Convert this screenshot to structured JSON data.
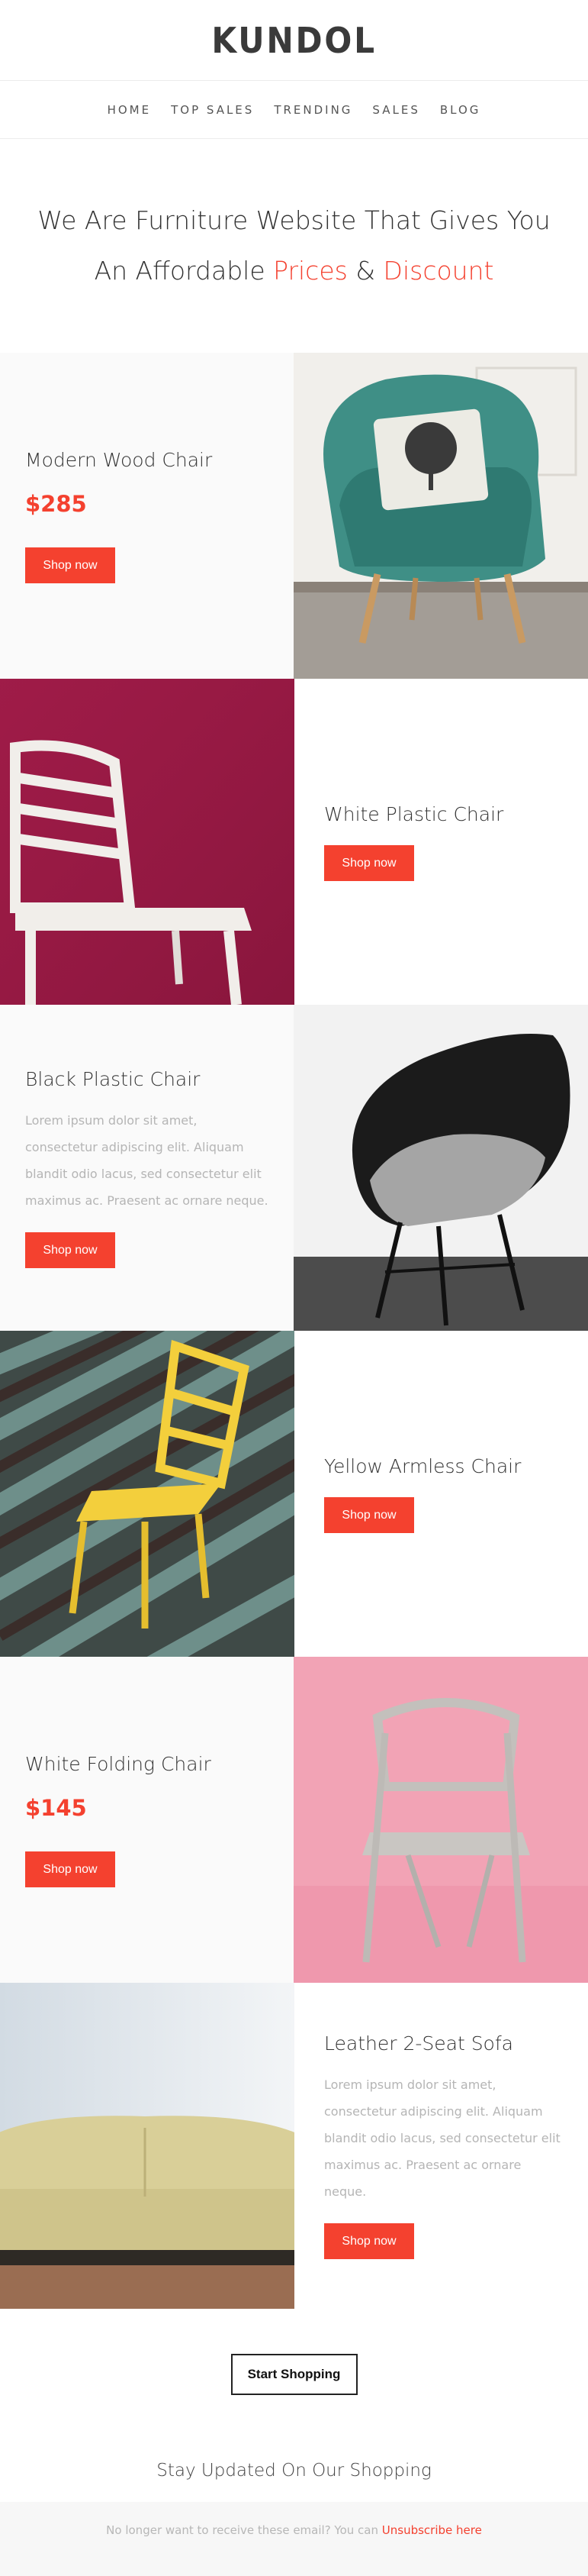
{
  "brand": {
    "logo_text": "KUNDOL"
  },
  "nav": {
    "items": [
      {
        "label": "HOME"
      },
      {
        "label": "TOP SALES"
      },
      {
        "label": "TRENDING"
      },
      {
        "label": "SALES"
      },
      {
        "label": "BLOG"
      }
    ]
  },
  "hero": {
    "line1": "We Are Furniture Website That Gives You",
    "line2_prefix": "An Affordable ",
    "line2_accent1": "Prices",
    "line2_amp": " & ",
    "line2_accent2": "Discount"
  },
  "products": [
    {
      "title": "Modern Wood Chair",
      "price": "$285",
      "button": "Shop now"
    },
    {
      "title": "White Plastic Chair",
      "button": "Shop now"
    },
    {
      "title": "Black Plastic Chair",
      "description": "Lorem ipsum dolor sit amet, consectetur adipiscing elit. Aliquam blandit odio lacus, sed consectetur elit maximus ac. Praesent ac ornare neque.",
      "button": "Shop now"
    },
    {
      "title": "Yellow Armless Chair",
      "button": "Shop now"
    },
    {
      "title": "White Folding Chair",
      "price": "$145",
      "button": "Shop now"
    },
    {
      "title": "Leather 2-Seat Sofa",
      "description": "Lorem ipsum dolor sit amet, consectetur adipiscing elit. Aliquam blandit odio lacus, sed consectetur elit maximus ac. Praesent ac ornare neque.",
      "button": "Shop now"
    }
  ],
  "cta": {
    "label": "Start Shopping"
  },
  "updates": {
    "heading": "Stay Updated On Our Shopping"
  },
  "footer": {
    "text": "No longer want to receive these email? You can ",
    "link": "Unsubscribe here"
  },
  "colors": {
    "accent": "#f4412f",
    "text": "#333333",
    "muted": "#b5b5b5"
  }
}
